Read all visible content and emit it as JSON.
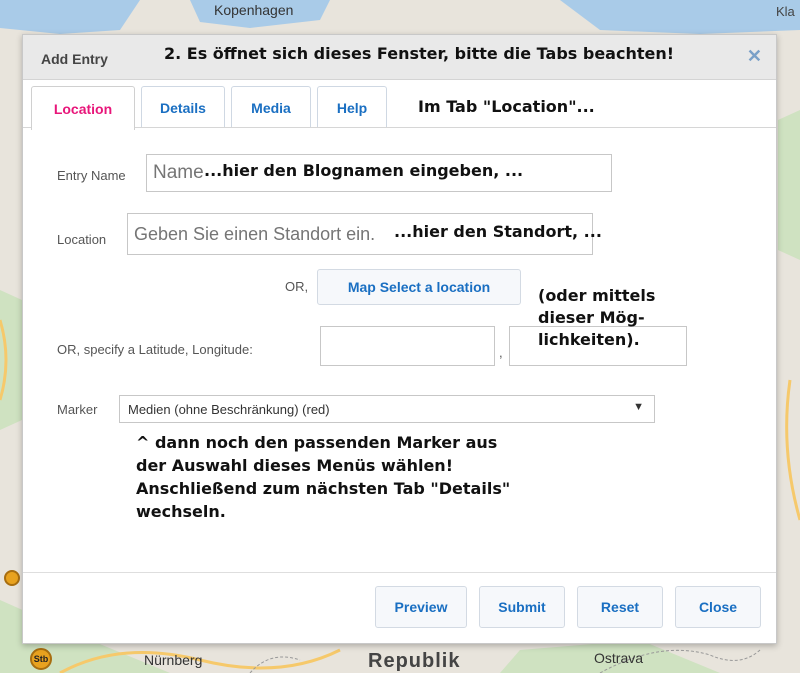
{
  "map": {
    "labels": {
      "copenhagen": "Kopenhagen",
      "top_right": "Kla",
      "nuernberg": "Nürnberg",
      "republik": "Republik",
      "ostrava": "Ostrava",
      "badge": "Stb"
    },
    "colors": {
      "land": "#e8e4dc",
      "water": "#a9cbe8",
      "road": "#f6c96b",
      "green": "#cfe2c1"
    }
  },
  "dialog": {
    "title": "Add Entry",
    "close_icon": "close-icon",
    "tabs": [
      {
        "label": "Location",
        "active": true
      },
      {
        "label": "Details",
        "active": false
      },
      {
        "label": "Media",
        "active": false
      },
      {
        "label": "Help",
        "active": false
      }
    ],
    "fields": {
      "entry_name": {
        "label": "Entry Name",
        "placeholder": "Name"
      },
      "location": {
        "label": "Location",
        "placeholder": "Geben Sie einen Standort ein."
      },
      "or_label": "OR,",
      "map_select_button": "Map Select a location",
      "latlng_label": "OR, specify a Latitude, Longitude:",
      "latlng_separator": ",",
      "marker": {
        "label": "Marker",
        "value": "Medien (ohne Beschränkung) (red)"
      }
    },
    "buttons": {
      "preview": "Preview",
      "submit": "Submit",
      "reset": "Reset",
      "close": "Close"
    },
    "colors": {
      "active_tab": "#e8167a",
      "link": "#1a6fc2"
    }
  },
  "annotations": {
    "title_note": "2. Es öffnet sich dieses Fenster, bitte die Tabs beachten!",
    "tab_note": "Im Tab \"Location\"...",
    "name_note": "...hier den Blognamen eingeben, ...",
    "location_note": "...hier den Standort, ...",
    "options_note_1": "(oder mittels",
    "options_note_2": "dieser Mög-",
    "options_note_3": "lichkeiten).",
    "marker_note_1": "^ dann noch den passenden Marker aus",
    "marker_note_2": "der Auswahl dieses Menüs wählen!",
    "marker_note_3": "Anschließend zum nächsten Tab \"Details\"",
    "marker_note_4": "wechseln."
  }
}
